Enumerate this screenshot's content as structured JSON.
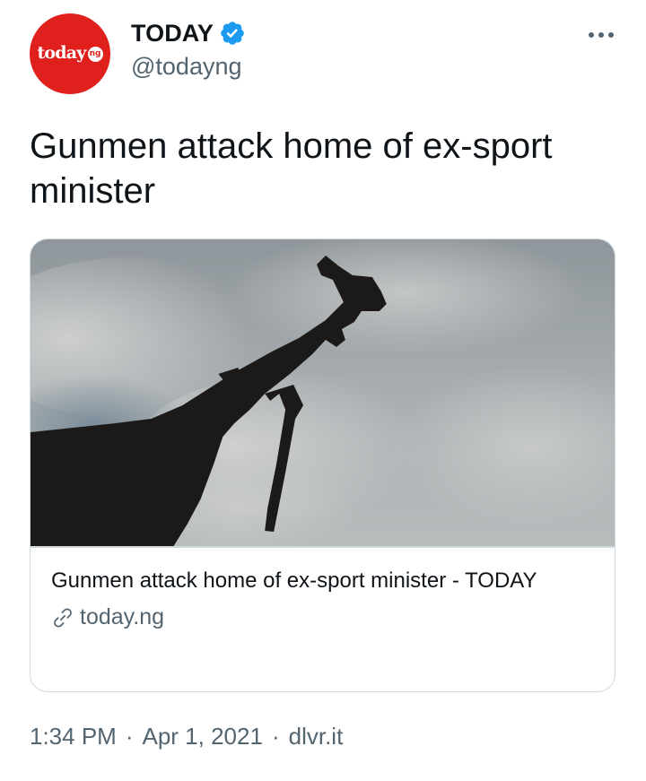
{
  "author": {
    "display_name": "TODAY",
    "handle": "@todayng",
    "verified": true,
    "avatar": {
      "wordmark": "today",
      "badge": "ng",
      "background_color": "#e0201d",
      "icon": "avatar-logo"
    }
  },
  "menu": {
    "icon": "more-horizontal-icon"
  },
  "tweet": {
    "text": "Gunmen attack home of ex-sport minister"
  },
  "card": {
    "image_icon": "rifle-silhouette-against-cloudy-sky",
    "title": "Gunmen attack home of ex-sport minister - TODAY",
    "domain": "today.ng",
    "domain_icon": "link-icon"
  },
  "meta": {
    "time": "1:34 PM",
    "date": "Apr 1, 2021",
    "separator": "·",
    "source": "dlvr.it"
  },
  "colors": {
    "text_primary": "#0f1419",
    "text_secondary": "#536471",
    "verified_blue": "#1d9bf0",
    "border": "#cfd9de",
    "brand_red": "#e0201d"
  }
}
